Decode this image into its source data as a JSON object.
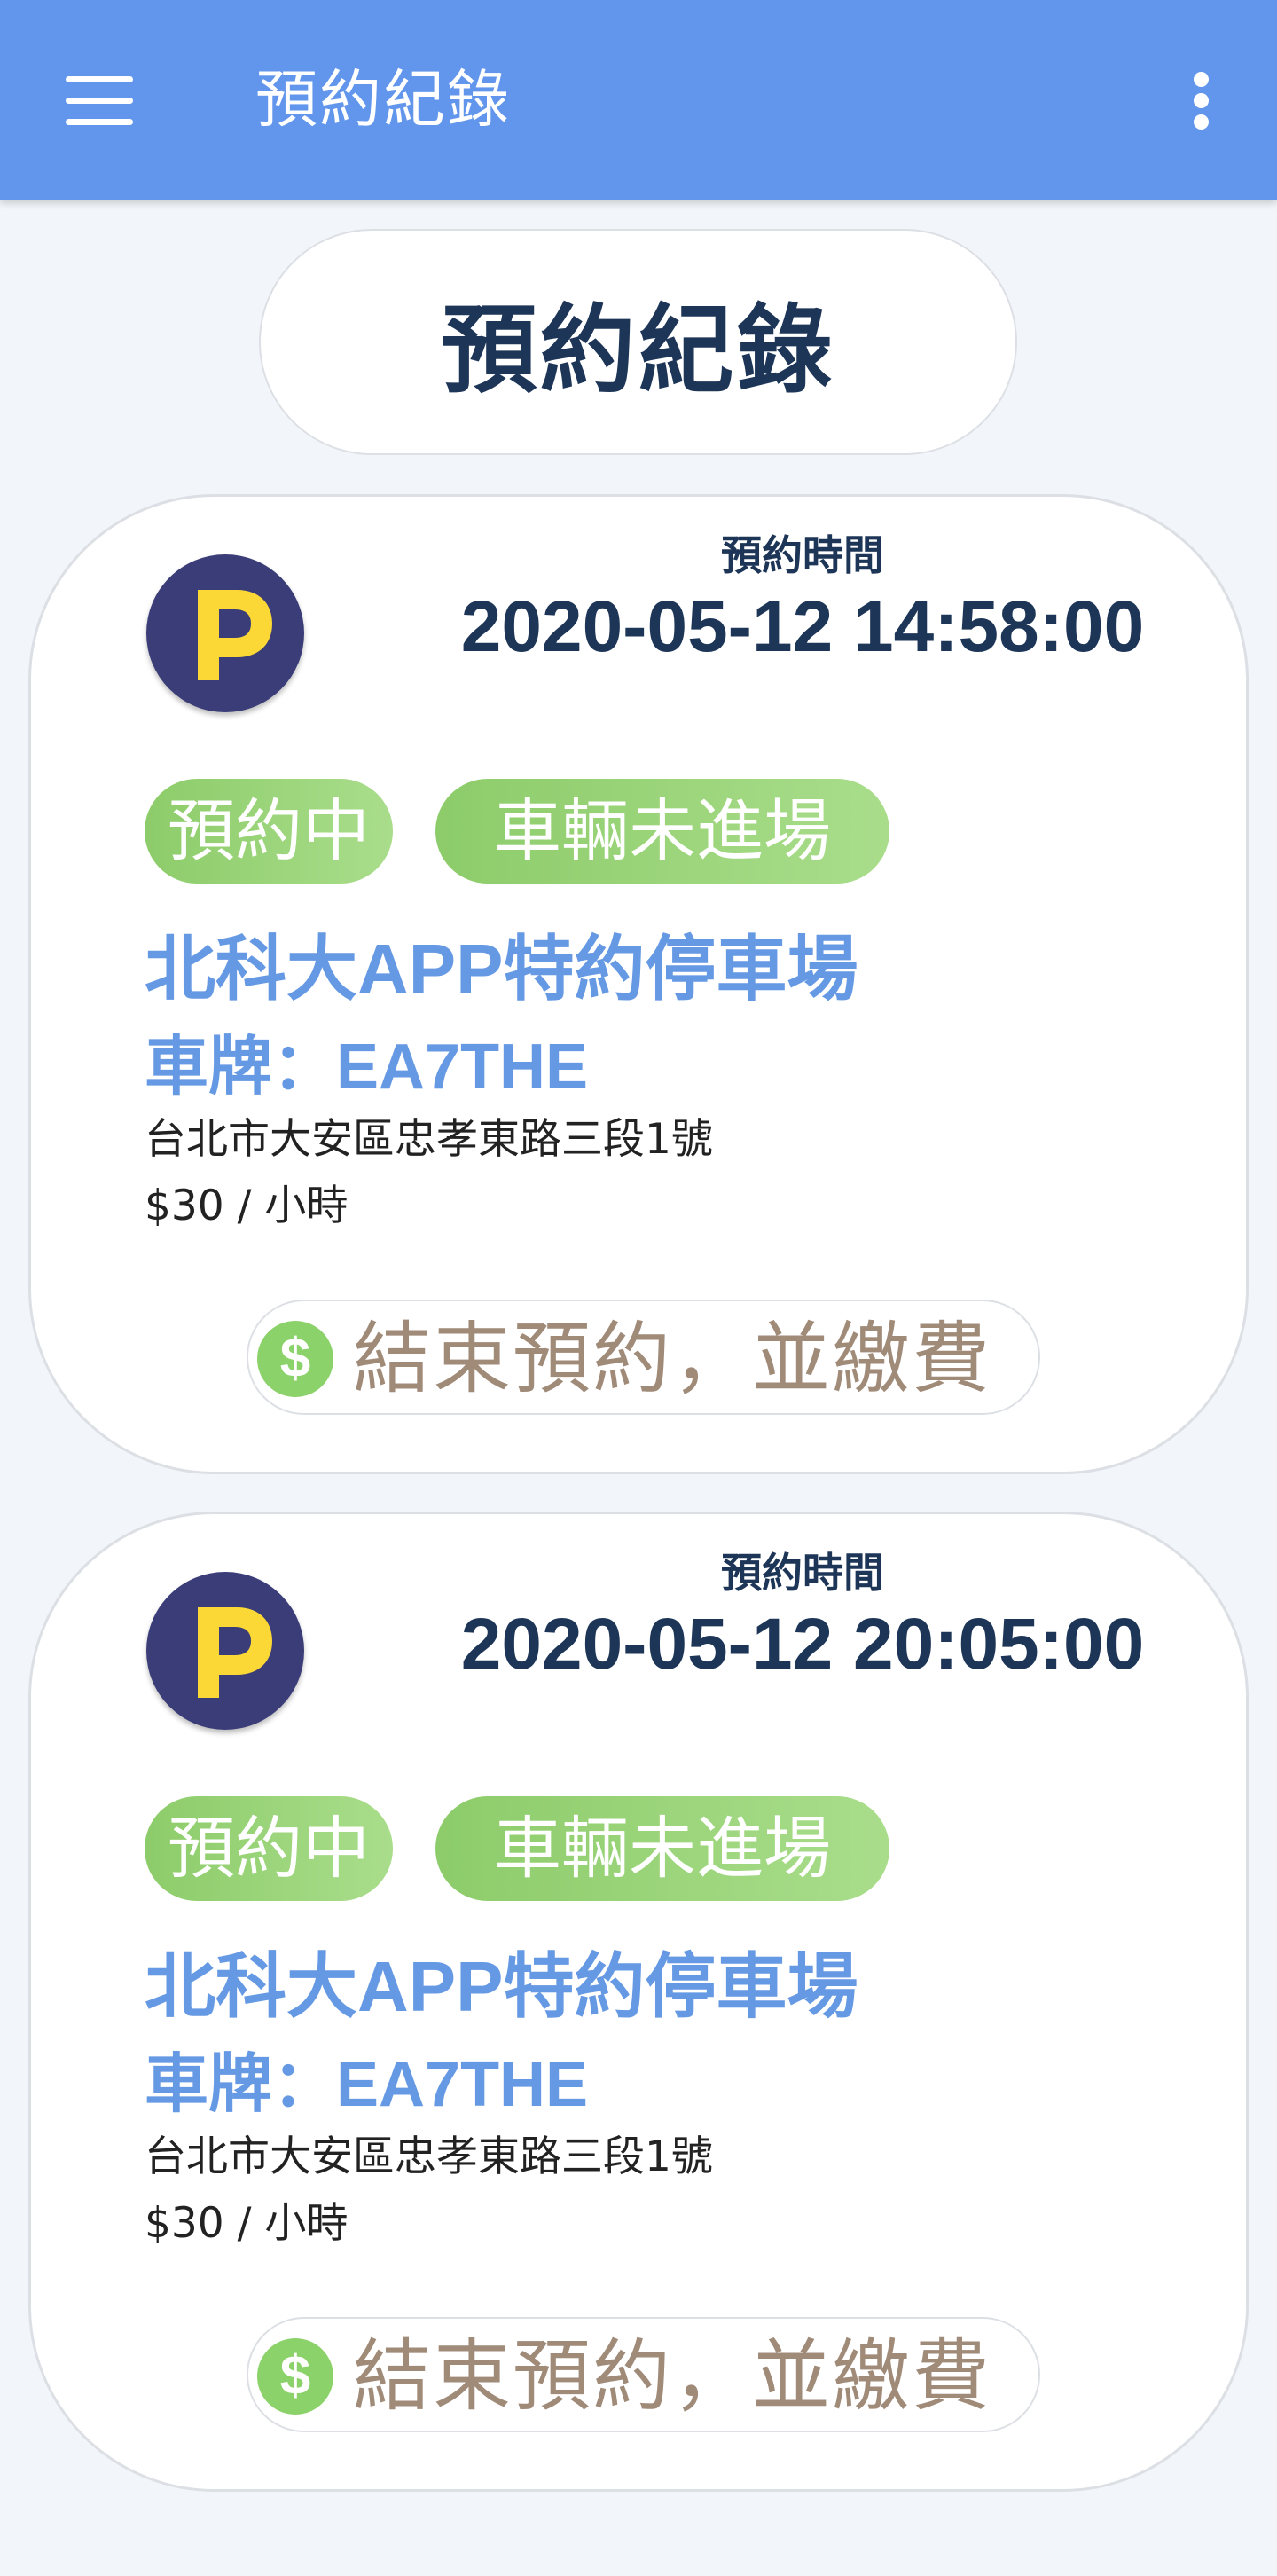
{
  "appbar": {
    "title": "預約紀錄",
    "menu_icon": "hamburger-menu-icon",
    "more_icon": "more-vertical-icon"
  },
  "page_title": "預約紀錄",
  "reservations": [
    {
      "time_label": "預約時間",
      "time": "2020-05-12 14:58:00",
      "status_badge": "預約中",
      "entry_badge": "車輛未進場",
      "lot_name": "北科大APP特約停車場",
      "plate_label": "車牌：",
      "plate": "EA7THE",
      "address": "台北市大安區忠孝東路三段1號",
      "price": "$30 / 小時",
      "action": "結束預約，並繳費"
    },
    {
      "time_label": "預約時間",
      "time": "2020-05-12 20:05:00",
      "status_badge": "預約中",
      "entry_badge": "車輛未進場",
      "lot_name": "北科大APP特約停車場",
      "plate_label": "車牌：",
      "plate": "EA7THE",
      "address": "台北市大安區忠孝東路三段1號",
      "price": "$30 / 小時",
      "action": "結束預約，並繳費"
    }
  ],
  "colors": {
    "appbar": "#6196ec",
    "primary_text": "#1d3557",
    "link_blue": "#6699e4",
    "badge_green": "#8dcc6a",
    "action_text": "#a08a78",
    "parking_icon_bg": "#3a3d78",
    "parking_icon_letter": "#fcd837"
  }
}
